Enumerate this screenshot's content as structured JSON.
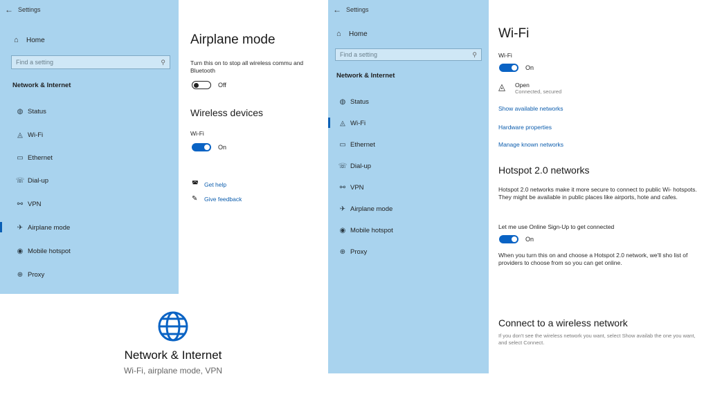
{
  "left_window": {
    "title": "Settings",
    "back_glyph": "←",
    "home": {
      "icon": "home-icon",
      "glyph": "⌂",
      "label": "Home"
    },
    "search": {
      "placeholder": "Find a setting",
      "icon_glyph": "⚲"
    },
    "section": "Network & Internet",
    "nav": [
      {
        "icon": "status-icon",
        "glyph": "◍",
        "label": "Status"
      },
      {
        "icon": "wifi-icon",
        "glyph": "◬",
        "label": "Wi-Fi"
      },
      {
        "icon": "ethernet-icon",
        "glyph": "▭",
        "label": "Ethernet"
      },
      {
        "icon": "dialup-icon",
        "glyph": "☏",
        "label": "Dial-up"
      },
      {
        "icon": "vpn-icon",
        "glyph": "⚯",
        "label": "VPN"
      },
      {
        "icon": "airplane-icon",
        "glyph": "✈",
        "label": "Airplane mode"
      },
      {
        "icon": "hotspot-icon",
        "glyph": "◉",
        "label": "Mobile hotspot"
      },
      {
        "icon": "proxy-icon",
        "glyph": "⊕",
        "label": "Proxy"
      }
    ],
    "active_index": 5,
    "page_title": "Airplane mode",
    "description": "Turn this on to stop all wireless commu and Bluetooth",
    "airplane_toggle": "Off",
    "wireless_title": "Wireless devices",
    "wifi_label": "Wi-Fi",
    "wifi_toggle": "On",
    "help": {
      "glyph": "◚",
      "label": "Get help"
    },
    "feedback": {
      "glyph": "✎",
      "label": "Give feedback"
    }
  },
  "tile": {
    "icon": "globe-icon",
    "title": "Network & Internet",
    "subtitle": "Wi-Fi, airplane mode, VPN",
    "color": "#0a63c4"
  },
  "right_window": {
    "title": "Settings",
    "back_glyph": "←",
    "home": {
      "icon": "home-icon",
      "glyph": "⌂",
      "label": "Home"
    },
    "search": {
      "placeholder": "Find a setting",
      "icon_glyph": "⚲"
    },
    "section": "Network & Internet",
    "nav": [
      {
        "icon": "status-icon",
        "glyph": "◍",
        "label": "Status"
      },
      {
        "icon": "wifi-icon",
        "glyph": "◬",
        "label": "Wi-Fi"
      },
      {
        "icon": "ethernet-icon",
        "glyph": "▭",
        "label": "Ethernet"
      },
      {
        "icon": "dialup-icon",
        "glyph": "☏",
        "label": "Dial-up"
      },
      {
        "icon": "vpn-icon",
        "glyph": "⚯",
        "label": "VPN"
      },
      {
        "icon": "airplane-icon",
        "glyph": "✈",
        "label": "Airplane mode"
      },
      {
        "icon": "hotspot-icon",
        "glyph": "◉",
        "label": "Mobile hotspot"
      },
      {
        "icon": "proxy-icon",
        "glyph": "⊕",
        "label": "Proxy"
      }
    ],
    "active_index": 1,
    "page_title": "Wi-Fi",
    "wifi_label": "Wi-Fi",
    "wifi_toggle": "On",
    "network": {
      "glyph": "◬",
      "name": "Open",
      "status": "Connected, secured"
    },
    "links": [
      "Show available networks",
      "Hardware properties",
      "Manage known networks"
    ],
    "hotspot_title": "Hotspot 2.0 networks",
    "hotspot_desc": "Hotspot 2.0 networks make it more secure to connect to public Wi- hotspots. They might be available in public places like airports, hote and cafes.",
    "signup_label": "Let me use Online Sign-Up to get connected",
    "signup_toggle": "On",
    "signup_desc": "When you turn this on and choose a Hotspot 2.0 network, we'll sho list of providers to choose from so you can get online.",
    "connect_title": "Connect to a wireless network",
    "connect_desc": "If you don't see the wireless network you want, select Show availab the one you want, and select Connect."
  },
  "colors": {
    "sidebar": "#a9d3ee",
    "accent": "#0a63c4",
    "link": "#0b5cad"
  }
}
